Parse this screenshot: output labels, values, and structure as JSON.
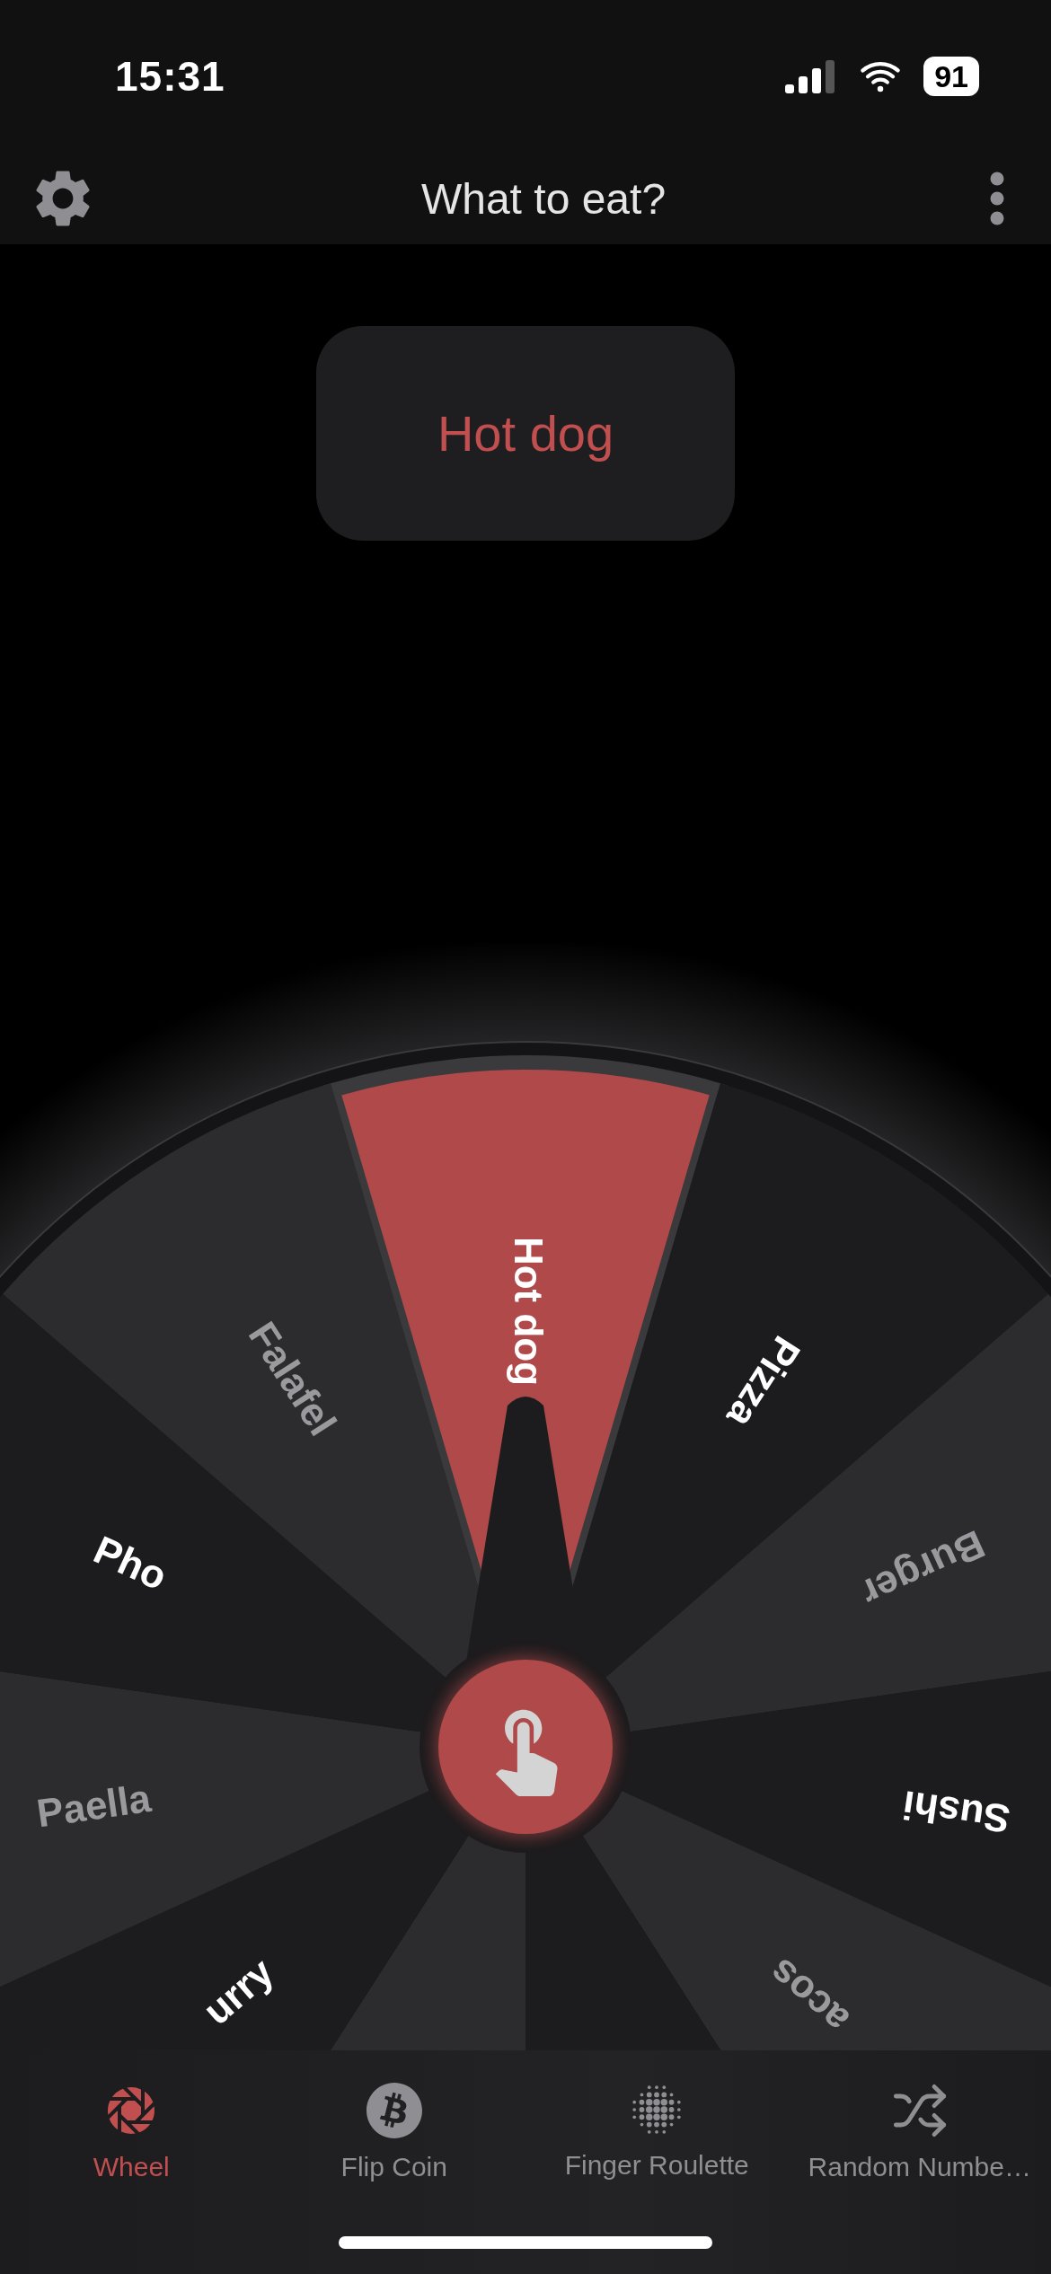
{
  "status_bar": {
    "time": "15:31",
    "battery": "91"
  },
  "header": {
    "title": "What to eat?"
  },
  "result": {
    "text": "Hot dog"
  },
  "wheel": {
    "segments": [
      {
        "label": "Hot dog",
        "selected": true
      },
      {
        "label": "Pizza",
        "selected": false
      },
      {
        "label": "Burger",
        "selected": false
      },
      {
        "label": "Sushi",
        "selected": false
      },
      {
        "label": "acos",
        "selected": false
      },
      {
        "selected": false
      },
      {
        "selected": false
      },
      {
        "label": "urry",
        "selected": false
      },
      {
        "label": "Paella",
        "selected": false
      },
      {
        "label": "Pho",
        "selected": false
      },
      {
        "label": "Falafel",
        "selected": false
      }
    ]
  },
  "tabs": [
    {
      "label": "Wheel",
      "selected": true
    },
    {
      "label": "Flip Coin",
      "selected": false
    },
    {
      "label": "Finger Roulette",
      "selected": false
    },
    {
      "label": "Random Numbe…",
      "selected": false
    }
  ]
}
